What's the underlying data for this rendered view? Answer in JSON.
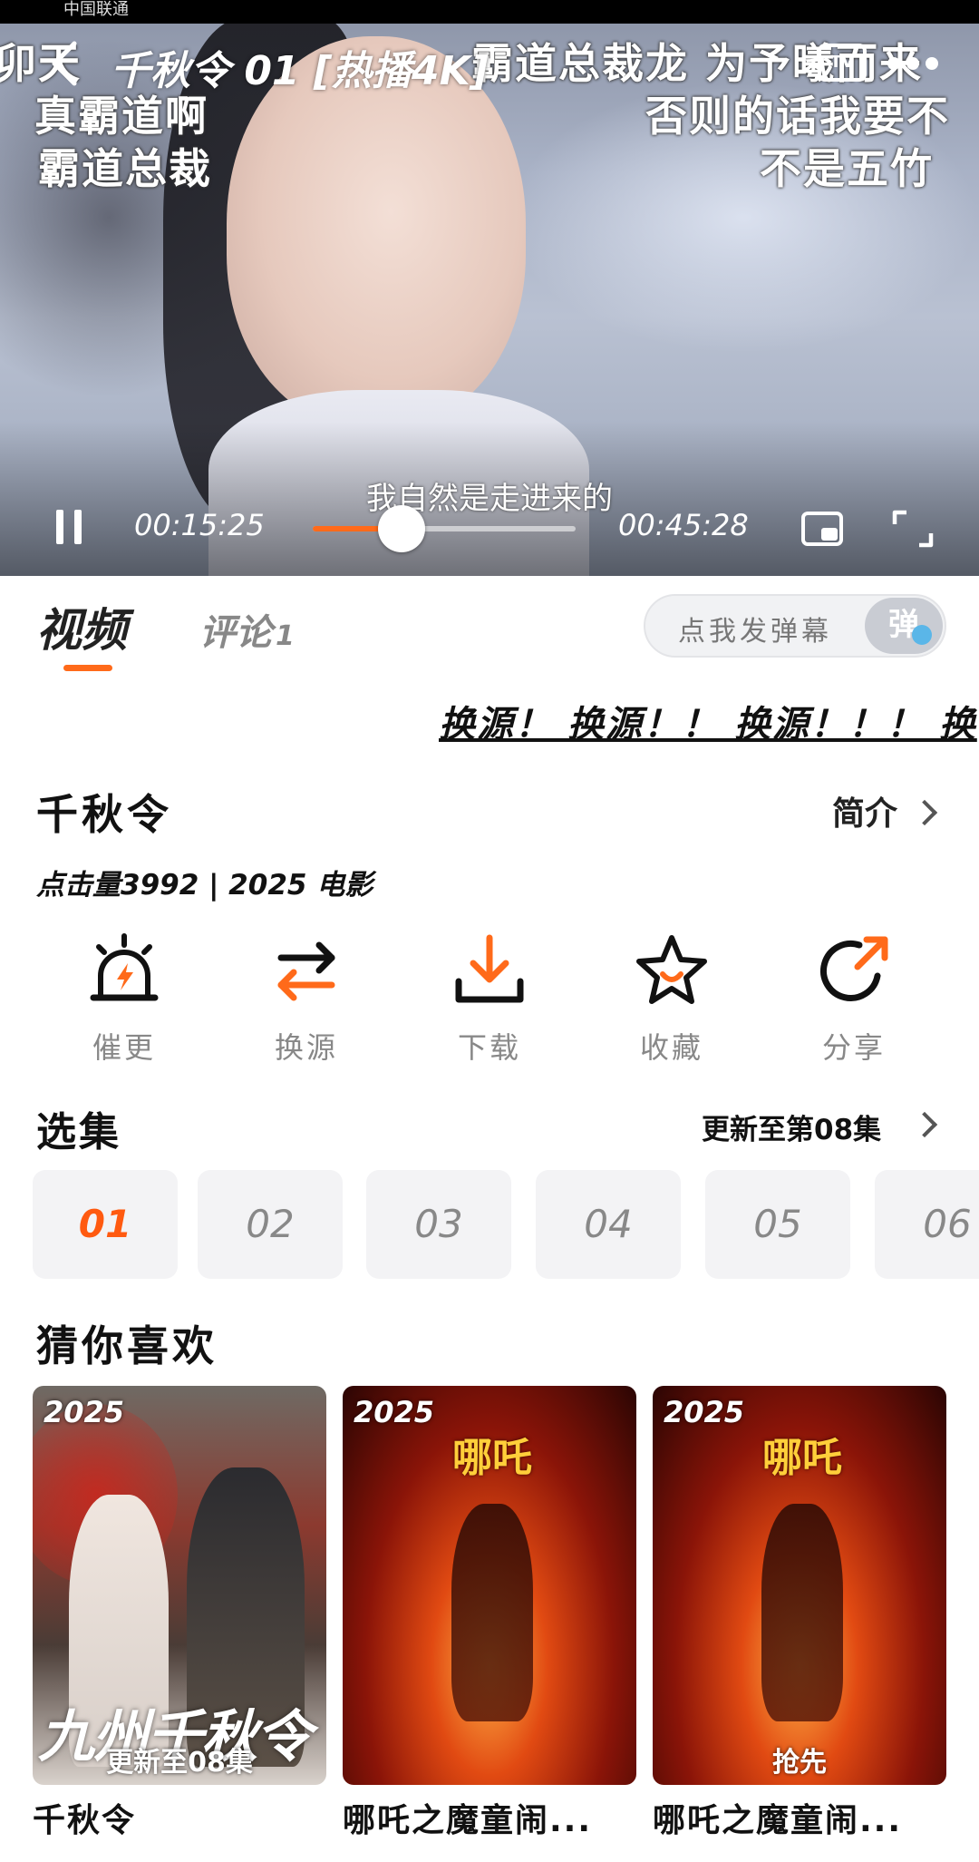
{
  "status_bar": {
    "carrier": "中国联通"
  },
  "player": {
    "title": "千秋令 01 [热播4K]",
    "tv_label": "TV",
    "current_time": "00:15:25",
    "total_time": "00:45:28",
    "progress": 0.339,
    "subtitle": "我自然是走进来的",
    "danmaku": [
      "卯天",
      "真霸道啊",
      "霸道总裁",
      "霸道总裁龙  为予曦而来",
      "否则的话我要不",
      "不是五竹"
    ]
  },
  "tabs": {
    "video": "视频",
    "comments": "评论",
    "comments_count": "1",
    "danmaku_placeholder": "点我发弹幕",
    "danmaku_toggle": "弹"
  },
  "marquee": "换源！ 换源！！ 换源！！！ 换",
  "info": {
    "title": "千秋令",
    "intro_label": "简介",
    "meta": "点击量3992 | 2025 电影"
  },
  "actions": [
    {
      "label": "催更",
      "icon": "alarm-icon"
    },
    {
      "label": "换源",
      "icon": "swap-icon"
    },
    {
      "label": "下载",
      "icon": "download-icon"
    },
    {
      "label": "收藏",
      "icon": "star-icon"
    },
    {
      "label": "分享",
      "icon": "share-icon"
    }
  ],
  "episodes": {
    "heading": "选集",
    "update_label": "更新至第08集",
    "items": [
      "01",
      "02",
      "03",
      "04",
      "05",
      "06"
    ],
    "selected": "01"
  },
  "recommend": {
    "heading": "猜你喜欢",
    "items": [
      {
        "year": "2025",
        "badge": "更新至08集",
        "name": "千秋令",
        "poster_text": "九州千秋令"
      },
      {
        "year": "2025",
        "badge": "",
        "name": "哪吒之魔童闹...",
        "poster_text": "哪吒"
      },
      {
        "year": "2025",
        "badge": "抢先",
        "name": "哪吒之魔童闹...",
        "poster_text": "哪吒"
      }
    ]
  },
  "colors": {
    "accent": "#ff6a1a",
    "episode_selected": "#ff5a10",
    "muted": "#888888"
  }
}
